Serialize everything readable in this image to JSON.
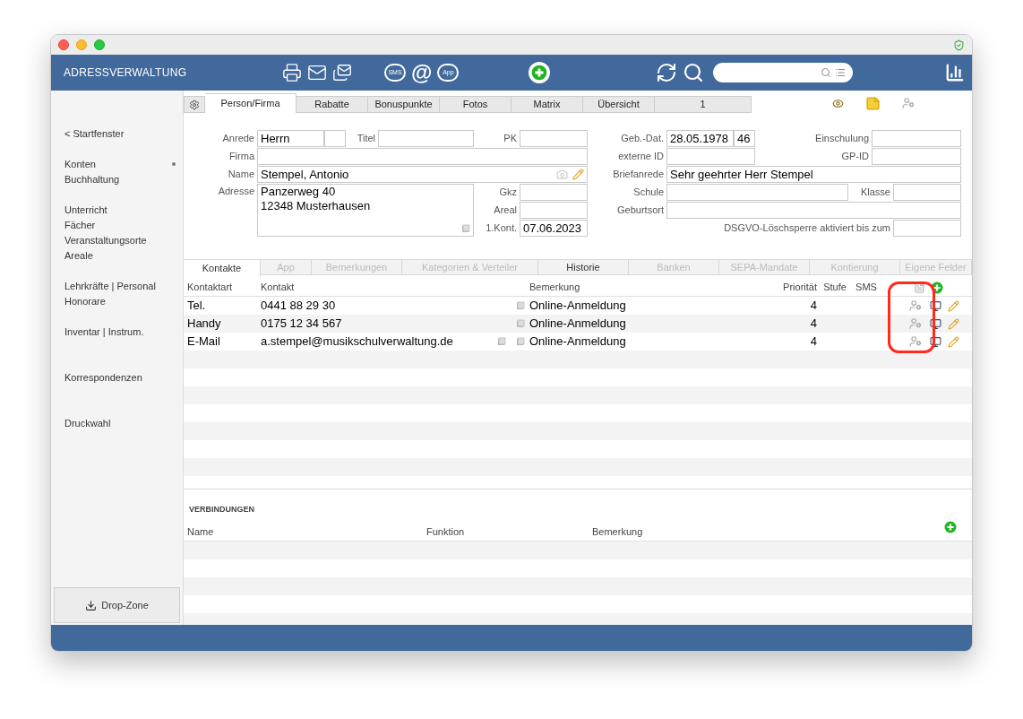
{
  "header": {
    "title": "ADRESSVERWALTUNG",
    "sms_label": "SMS",
    "at_label": "@",
    "app_label": "App"
  },
  "sidebar": {
    "back_link": "< Startfenster",
    "groups": [
      {
        "items": [
          {
            "label": "Konten",
            "marked": true
          },
          {
            "label": "Buchhaltung",
            "marked": false
          }
        ]
      },
      {
        "items": [
          {
            "label": "Unterricht",
            "marked": false
          },
          {
            "label": "Fächer",
            "marked": false
          },
          {
            "label": "Veranstaltungsorte",
            "marked": false
          },
          {
            "label": "Areale",
            "marked": false
          }
        ]
      },
      {
        "items": [
          {
            "label": "Lehrkräfte | Personal",
            "marked": false
          },
          {
            "label": "Honorare",
            "marked": false
          }
        ]
      },
      {
        "items": [
          {
            "label": "Inventar | Instrum.",
            "marked": false
          }
        ]
      },
      {
        "items": [
          {
            "label": "Korrespondenzen",
            "marked": false
          }
        ]
      },
      {
        "items": [
          {
            "label": "Druckwahl",
            "marked": false
          }
        ]
      }
    ],
    "drop_zone": "Drop-Zone"
  },
  "tabs": [
    {
      "label": "Person/Firma",
      "selected": true
    },
    {
      "label": "Rabatte",
      "selected": false
    },
    {
      "label": "Bonuspunkte",
      "selected": false
    },
    {
      "label": "Fotos",
      "selected": false
    },
    {
      "label": "Matrix",
      "selected": false
    },
    {
      "label": "Übersicht",
      "selected": false
    },
    {
      "label": "1",
      "selected": false
    }
  ],
  "form": {
    "anrede": {
      "label": "Anrede",
      "value": "Herrn"
    },
    "titel": {
      "label": "Titel"
    },
    "pk": {
      "label": "PK"
    },
    "firma": {
      "label": "Firma"
    },
    "name": {
      "label": "Name",
      "value": "Stempel, Antonio"
    },
    "adresse": {
      "label": "Adresse",
      "lines": [
        "Panzerweg 40",
        "12348 Musterhausen"
      ]
    },
    "gkz": {
      "label": "Gkz"
    },
    "areal": {
      "label": "Areal"
    },
    "erstkontakt": {
      "label": "1.Kont.",
      "value": "07.06.2023"
    },
    "geb_dat": {
      "label": "Geb.-Dat.",
      "value": "28.05.1978",
      "age": "46"
    },
    "einschulung": {
      "label": "Einschulung"
    },
    "externe_id": {
      "label": "externe ID"
    },
    "gp_id": {
      "label": "GP-ID"
    },
    "briefanrede": {
      "label": "Briefanrede",
      "value": "Sehr geehrter Herr Stempel"
    },
    "schule": {
      "label": "Schule"
    },
    "klasse": {
      "label": "Klasse"
    },
    "geburtsort": {
      "label": "Geburtsort"
    },
    "dsgvo": {
      "label": "DSGVO-Löschsperre aktiviert bis zum"
    }
  },
  "subtabs": [
    {
      "label": "Kontakte",
      "selected": true,
      "disabled": false
    },
    {
      "label": "App",
      "selected": false,
      "disabled": true
    },
    {
      "label": "Bemerkungen",
      "selected": false,
      "disabled": true
    },
    {
      "label": "Kategorien & Verteiler",
      "selected": false,
      "disabled": true
    },
    {
      "label": "Historie",
      "selected": false,
      "disabled": false
    },
    {
      "label": "Banken",
      "selected": false,
      "disabled": true
    },
    {
      "label": "SEPA-Mandate",
      "selected": false,
      "disabled": true
    },
    {
      "label": "Kontierung",
      "selected": false,
      "disabled": true
    },
    {
      "label": "Eigene Felder",
      "selected": false,
      "disabled": true
    }
  ],
  "contacts": {
    "columns": [
      "Kontaktart",
      "Kontakt",
      "Bemerkung",
      "Priorität",
      "Stufe",
      "SMS"
    ],
    "rows": [
      {
        "kontaktart": "Tel.",
        "kontakt": "0441 88 29 30",
        "bemerkung": "Online-Anmeldung",
        "prioritaet": "4",
        "mail_action": false
      },
      {
        "kontaktart": "Handy",
        "kontakt": "0175 12 34 567",
        "bemerkung": "Online-Anmeldung",
        "prioritaet": "4",
        "mail_action": false
      },
      {
        "kontaktart": "E-Mail",
        "kontakt": "a.stempel@musikschulverwaltung.de",
        "bemerkung": "Online-Anmeldung",
        "prioritaet": "4",
        "mail_action": true
      }
    ]
  },
  "verbindungen": {
    "title": "VERBINDUNGEN",
    "columns": [
      "Name",
      "Funktion",
      "Bemerkung"
    ]
  }
}
